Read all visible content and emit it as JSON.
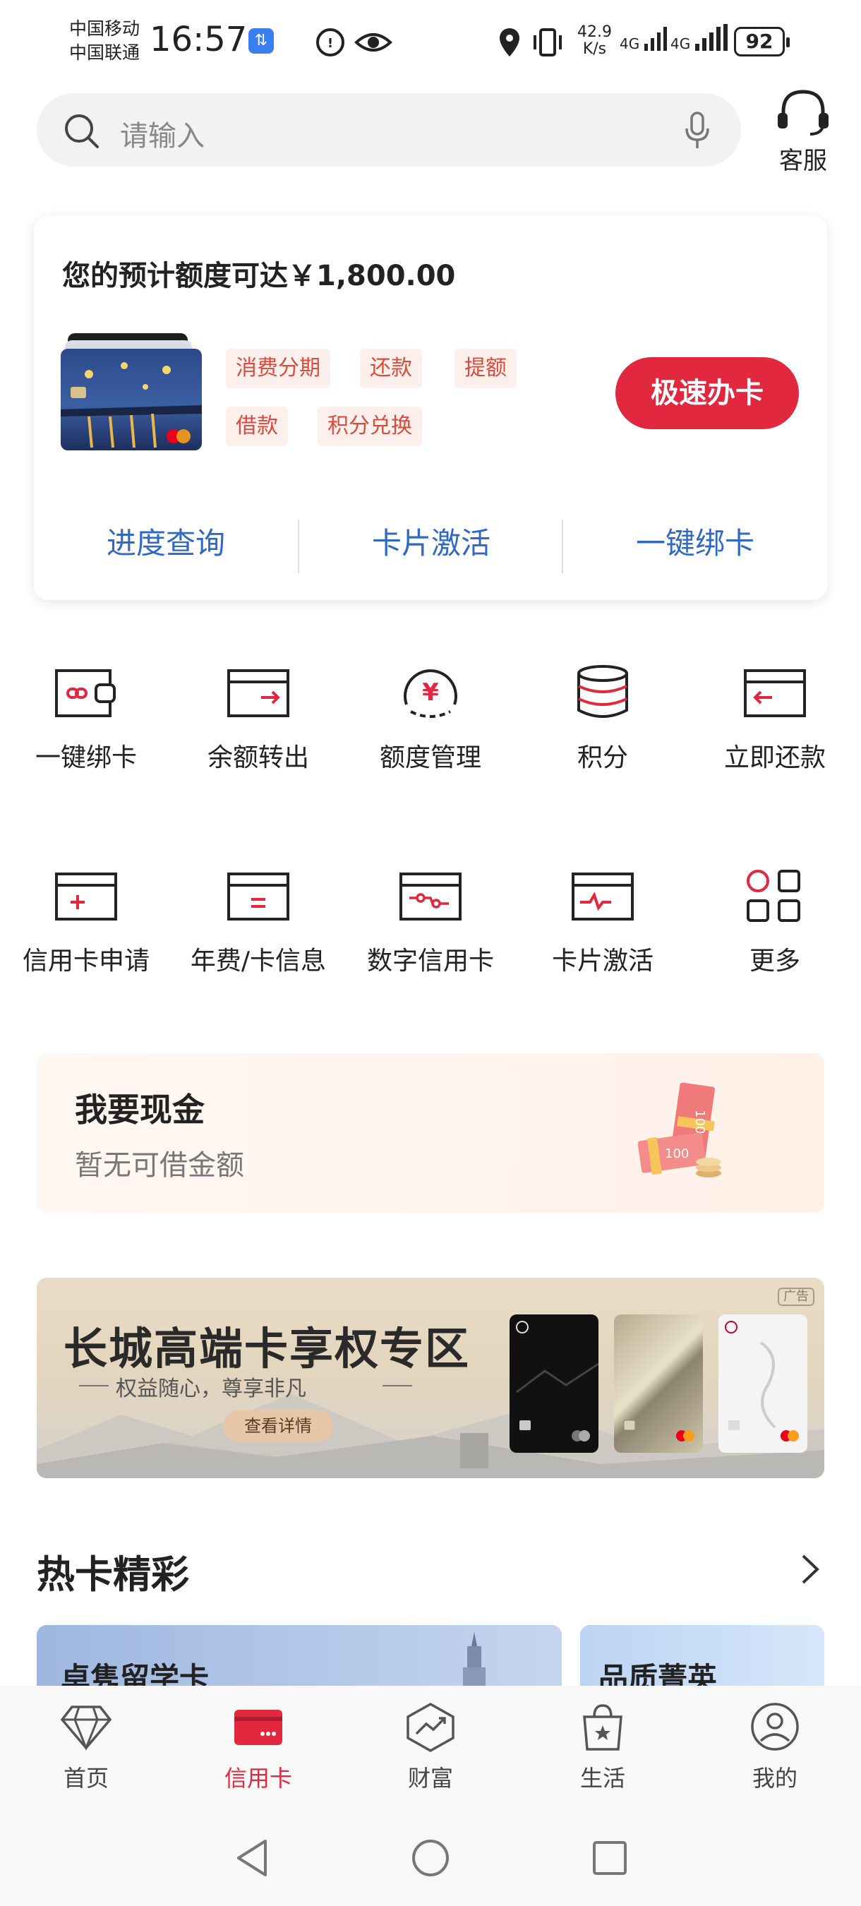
{
  "status_bar": {
    "carrier1": "中国移动",
    "carrier2": "中国联通",
    "time": "16:57",
    "net_speed_value": "42.9",
    "net_speed_unit": "K/s",
    "signal1": "4G",
    "signal2": "4G",
    "battery": "92"
  },
  "search": {
    "placeholder": "请输入"
  },
  "service": {
    "label": "客服"
  },
  "card_panel": {
    "limit_text": "您的预计额度可达￥1,800.00",
    "tags": [
      "消费分期",
      "还款",
      "提额",
      "借款",
      "积分兑换"
    ],
    "apply_button": "极速办卡",
    "links": [
      "进度查询",
      "卡片激活",
      "一键绑卡"
    ]
  },
  "grid": {
    "row1": [
      "一键绑卡",
      "余额转出",
      "额度管理",
      "积分",
      "立即还款"
    ],
    "row2": [
      "信用卡申请",
      "年费/卡信息",
      "数字信用卡",
      "卡片激活",
      "更多"
    ]
  },
  "cash": {
    "title": "我要现金",
    "subtitle": "暂无可借金额"
  },
  "promo": {
    "title": "长城高端卡享权专区",
    "subtitle": "权益随心，尊享非凡",
    "button": "查看详情",
    "ad_tag": "广告"
  },
  "hot": {
    "title": "热卡精彩",
    "cards": [
      "卓隽留学卡",
      "品质菁英"
    ]
  },
  "bottom_nav": {
    "items": [
      "首页",
      "信用卡",
      "财富",
      "生活",
      "我的"
    ],
    "active_index": 1
  },
  "colors": {
    "accent": "#e2283f",
    "link_blue": "#3069c5",
    "tag_bg": "#fdf0ec",
    "tag_text": "#d94b3a"
  }
}
